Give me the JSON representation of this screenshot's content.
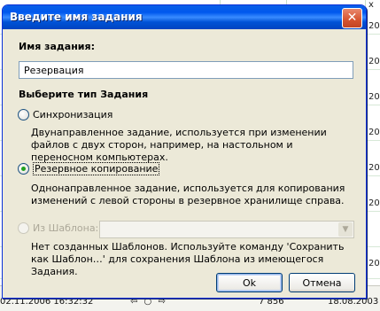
{
  "background": {
    "cells": [
      "x",
      "20",
      "20",
      "20",
      "20",
      "20",
      "20",
      "20"
    ],
    "status": {
      "datetime": "02.11.2006 16:32:32",
      "nav": "⇦ ○ ⇨",
      "count": "7 856",
      "date": "18.08.2003"
    }
  },
  "dialog": {
    "title": "Введите имя задания",
    "close_symbol": "✕",
    "name_label": "Имя задания:",
    "name_value": "Резервация",
    "type_label": "Выберите тип Задания",
    "options": [
      {
        "label": "Синхронизация",
        "checked": false,
        "enabled": true,
        "description": "Двунаправленное задание, используется при изменении файлов с двух сторон, например, на настольном и переносном компьютерах."
      },
      {
        "label": "Резервное копирование",
        "checked": true,
        "enabled": true,
        "description": "Однонаправленное задание, используется для копирования изменений с левой стороны в резервное хранилище справа."
      },
      {
        "label": "Из Шаблона:",
        "checked": false,
        "enabled": false,
        "description": "Нет созданных Шаблонов. Используйте команду 'Сохранить как Шаблон…' для сохранения Шаблона из имеющегося Задания."
      }
    ],
    "template_value": "",
    "ok_label": "Ok",
    "cancel_label": "Отмена"
  },
  "colors": {
    "titlebar": "#0058ee",
    "dialog_bg": "#ece9d8",
    "radio_selected": "#21a121",
    "close_button": "#d6542f"
  }
}
